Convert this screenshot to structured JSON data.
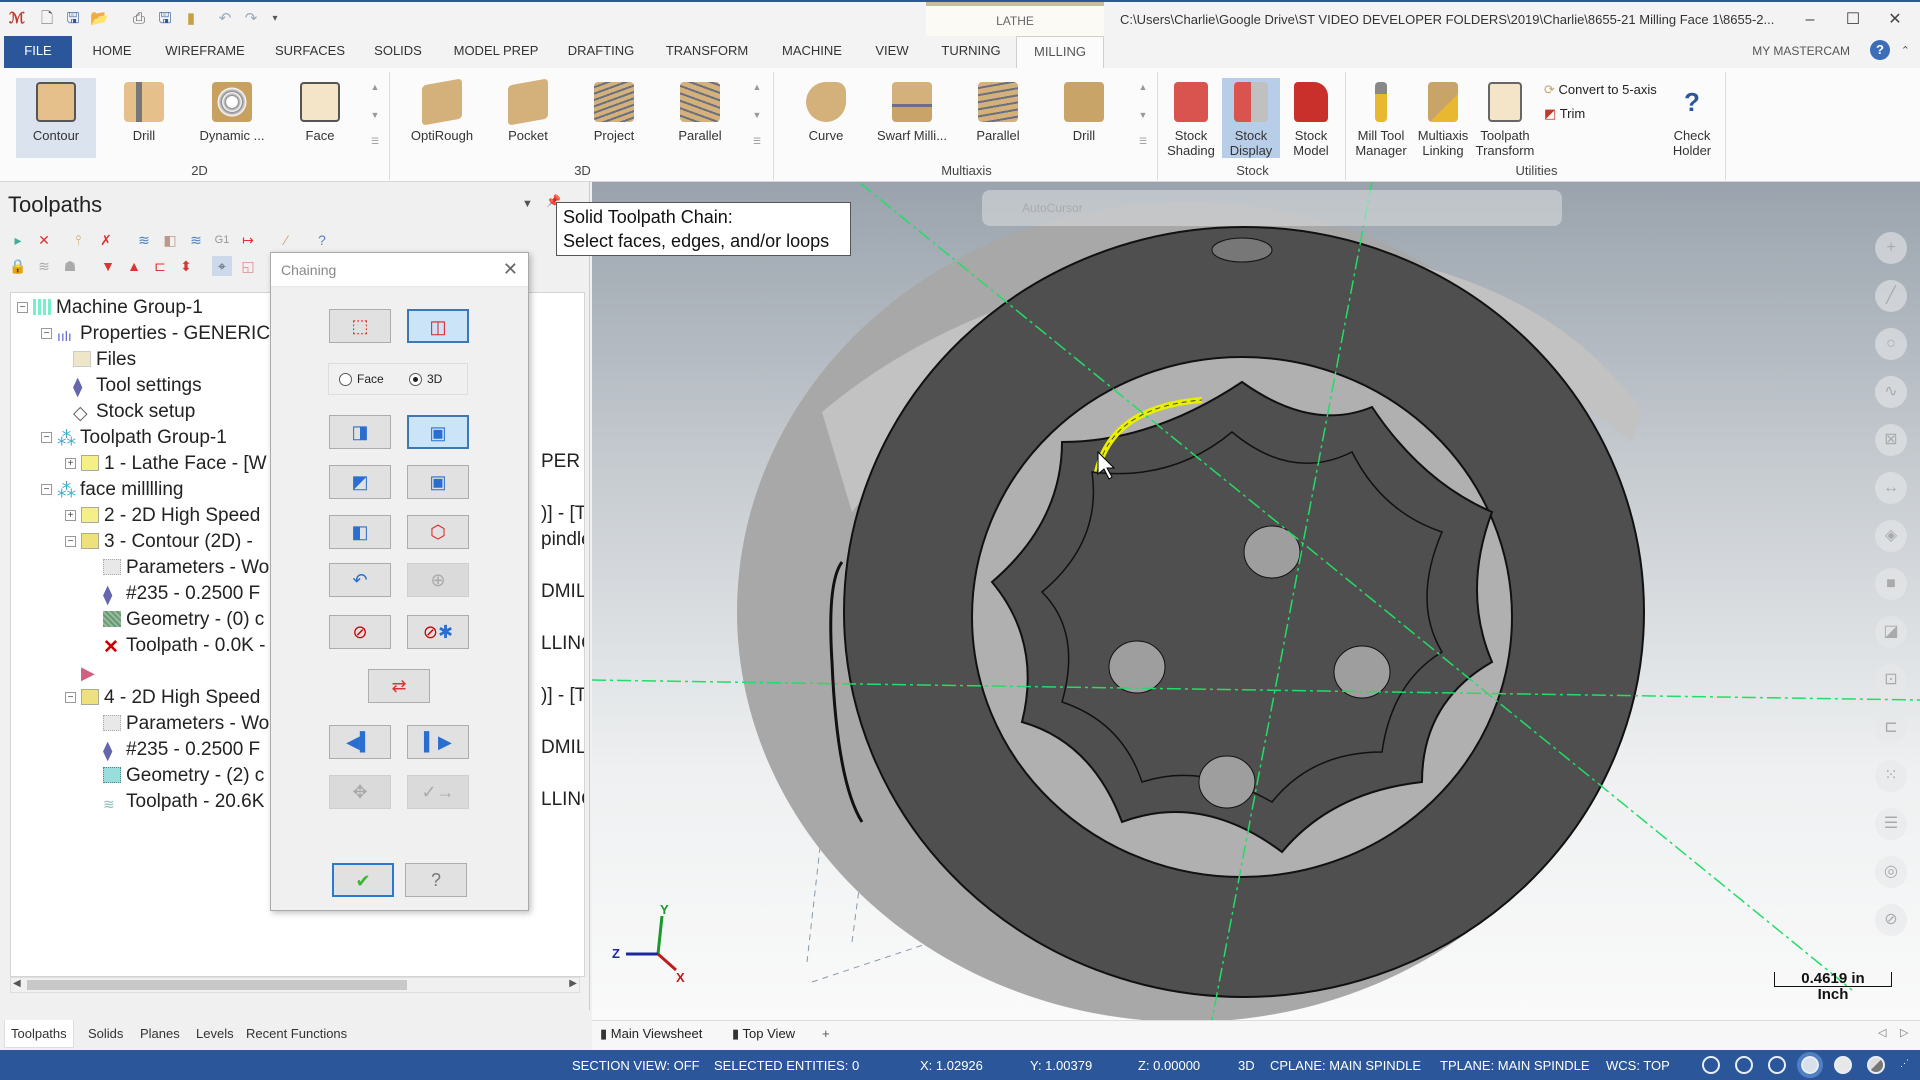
{
  "titlebar": {
    "app_icon": "mastercam-19-logo-icon",
    "quick_access": [
      "new-file-icon",
      "save-icon",
      "open-folder-icon",
      "print-icon",
      "save-as-icon",
      "file-manager-icon",
      "undo-icon",
      "redo-icon",
      "customize-dropdown-icon"
    ],
    "context_tab_group": "LATHE",
    "window_title": "C:\\Users\\Charlie\\Google Drive\\ST VIDEO DEVELOPER FOLDERS\\2019\\Charlie\\8655-21 Milling Face 1\\8655-2...",
    "minimize": "–",
    "maximize": "☐",
    "close": "✕"
  },
  "menu_tabs": {
    "items": [
      "FILE",
      "HOME",
      "WIREFRAME",
      "SURFACES",
      "SOLIDS",
      "MODEL PREP",
      "DRAFTING",
      "TRANSFORM",
      "MACHINE",
      "VIEW",
      "TURNING",
      "MILLING"
    ],
    "active": "MILLING",
    "my_mastercam": "MY MASTERCAM",
    "help": "?"
  },
  "ribbon": {
    "groups": [
      {
        "label": "2D",
        "buttons": [
          "Contour",
          "Drill",
          "Dynamic ...",
          "Face"
        ]
      },
      {
        "label": "3D",
        "buttons": [
          "OptiRough",
          "Pocket",
          "Project",
          "Parallel"
        ]
      },
      {
        "label": "Multiaxis",
        "buttons": [
          "Curve",
          "Swarf Milli...",
          "Parallel",
          "Drill"
        ]
      },
      {
        "label": "Stock",
        "buttons": [
          "Stock Shading",
          "Stock Display",
          "Stock Model"
        ]
      },
      {
        "label": "Utilities",
        "buttons": [
          "Mill Tool Manager",
          "Multiaxis Linking",
          "Toolpath Transform",
          "Check Holder"
        ],
        "small_buttons": [
          "Convert to 5-axis",
          "Trim"
        ]
      }
    ]
  },
  "left_panel": {
    "title": "Toolpaths",
    "tree": [
      {
        "label": "Machine Group-1",
        "suffix": ""
      },
      {
        "label": "Properties - GENERIC",
        "suffix": ""
      },
      {
        "label": "Files",
        "suffix": ""
      },
      {
        "label": "Tool settings",
        "suffix": ""
      },
      {
        "label": "Stock setup",
        "suffix": ""
      },
      {
        "label": "Toolpath Group-1",
        "suffix": ""
      },
      {
        "label": "1 - Lathe Face - [W",
        "suffix": "PER LI"
      },
      {
        "label": "face milllling",
        "suffix": ""
      },
      {
        "label": "2 - 2D High Speed",
        "suffix": ")] - [T"
      },
      {
        "label": "3 - Contour (2D) -",
        "suffix": "pindle]"
      },
      {
        "label": "Parameters - Wo",
        "suffix": ""
      },
      {
        "label": "#235 - 0.2500 F",
        "suffix": "DMILL"
      },
      {
        "label": "Geometry - (0) c",
        "suffix": ""
      },
      {
        "label": "Toolpath - 0.0K -",
        "suffix": "LLING_"
      },
      {
        "label": "",
        "suffix": ""
      },
      {
        "label": "4 - 2D High Speed",
        "suffix": ")] - [T"
      },
      {
        "label": "Parameters - Wo",
        "suffix": ""
      },
      {
        "label": "#235 - 0.2500 F",
        "suffix": "DMILL"
      },
      {
        "label": "Geometry - (2) c",
        "suffix": ""
      },
      {
        "label": "Toolpath - 20.6K",
        "suffix": "LLING"
      }
    ],
    "bottom_tabs": [
      "Toolpaths",
      "Solids",
      "Planes",
      "Levels",
      "Recent Functions"
    ],
    "active_bottom_tab": "Toolpaths"
  },
  "chaining_dialog": {
    "title": "Chaining",
    "close": "✕",
    "mode_options": [
      "Face",
      "3D"
    ],
    "selected_mode": "3D",
    "buttons": [
      "wireframe-mode",
      "solids-mode",
      "edge",
      "face",
      "partial-loop",
      "loop",
      "feature",
      "vertex-all",
      "back-up",
      "add",
      "unselect",
      "unselect-all",
      "reverse",
      "previous",
      "next",
      "options",
      "end-selection",
      "ok",
      "help"
    ],
    "ok_label": "✔",
    "help_label": "?"
  },
  "tooltip": {
    "line1": "Solid Toolpath Chain:",
    "line2": "Select faces, edges, and/or loops"
  },
  "viewport": {
    "autocursor_label": "AutoCursor",
    "scale_value": "0.4619 in",
    "scale_unit": "Inch",
    "axes": {
      "x": "X",
      "y": "Y",
      "z": "Z"
    },
    "tabs": [
      "Main Viewsheet",
      "Top View",
      "+"
    ],
    "highlight_color": "#e8f000",
    "axis_line_color": "#22dd66"
  },
  "status_bar": {
    "section_view": "SECTION VIEW: OFF",
    "selected_entities": "SELECTED ENTITIES: 0",
    "x": "X:  1.02926",
    "y": "Y:  1.00379",
    "z": "Z:  0.00000",
    "mode": "3D",
    "cplane": "CPLANE: MAIN SPINDLE",
    "tplane": "TPLANE: MAIN SPINDLE",
    "wcs": "WCS: TOP"
  }
}
